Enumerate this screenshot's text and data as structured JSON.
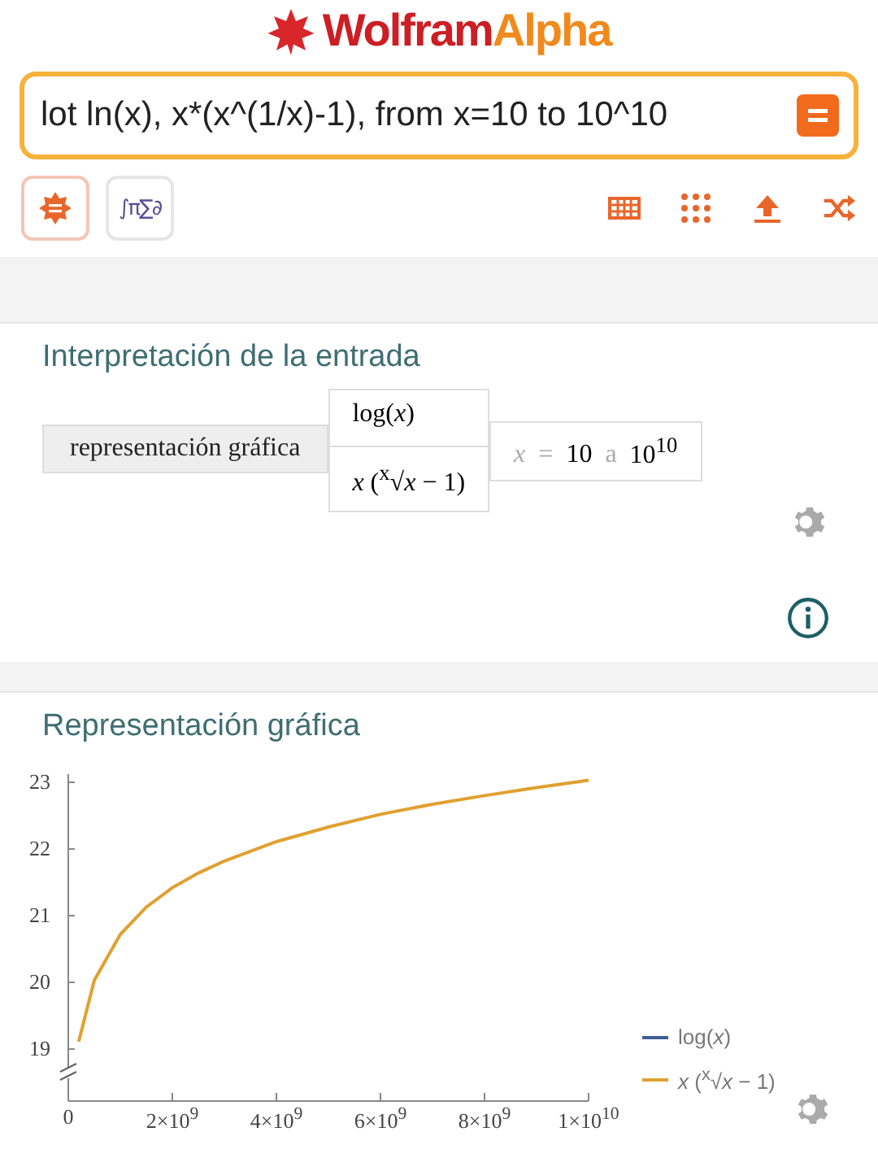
{
  "logo": {
    "text_1": "Wolfram",
    "text_2": "Alpha"
  },
  "search": {
    "value": "lot ln(x), x*(x^(1/x)-1), from x=10 to 10^10"
  },
  "toolbar": {
    "math_button": "∫π∑∂"
  },
  "interpretation": {
    "title": "Interpretación de la entrada",
    "command": "representación gráfica",
    "functions": [
      "log(*x*)",
      "*x* ($^{x}$√*x* − 1)"
    ],
    "range": {
      "variable": "x",
      "equals": "=",
      "from": "10",
      "word": "a",
      "to": "10$^{10}$"
    }
  },
  "plot": {
    "title": "Representación gráfica",
    "chart_data": {
      "type": "line",
      "x": [
        200000000,
        500000000,
        1000000000,
        1500000000,
        2000000000,
        2500000000,
        3000000000,
        4000000000,
        5000000000,
        6000000000,
        7000000000,
        8000000000,
        9000000000,
        10000000000
      ],
      "series": [
        {
          "name": "log(*x*)",
          "color": "#3f5f9a",
          "values": [
            null,
            null,
            null,
            null,
            null,
            null,
            null,
            null,
            null,
            null,
            null,
            null,
            null,
            null
          ]
        },
        {
          "name": "*x* ($^{x}$√*x* − 1)",
          "color": "#e0a030",
          "values": [
            19.11,
            20.03,
            20.72,
            21.13,
            21.42,
            21.64,
            21.82,
            22.11,
            22.33,
            22.52,
            22.67,
            22.8,
            22.92,
            23.03
          ]
        }
      ],
      "xlim": [
        0,
        10000000000
      ],
      "ylim": [
        18.22,
        23.1
      ],
      "legend": "right",
      "xticks": [
        {
          "value": 0,
          "label": "0"
        },
        {
          "value": 2000000000,
          "label": "2×10$^{9}$"
        },
        {
          "value": 4000000000,
          "label": "4×10$^{9}$"
        },
        {
          "value": 6000000000,
          "label": "6×10$^{9}$"
        },
        {
          "value": 8000000000,
          "label": "8×10$^{9}$"
        },
        {
          "value": 10000000000,
          "label": "1×10$^{10}$"
        }
      ],
      "yticks": [
        {
          "value": 19,
          "label": "19"
        },
        {
          "value": 20,
          "label": "20"
        },
        {
          "value": 21,
          "label": "21"
        },
        {
          "value": 22,
          "label": "22"
        },
        {
          "value": 23,
          "label": "23"
        }
      ]
    }
  }
}
